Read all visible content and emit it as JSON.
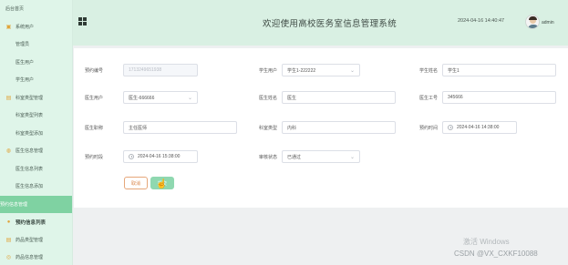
{
  "sidebar": {
    "items": [
      {
        "label": "后台首页",
        "kind": "top"
      },
      {
        "label": "系统用户",
        "kind": "group",
        "icon": "user-group-icon"
      },
      {
        "label": "管理员",
        "kind": "sub"
      },
      {
        "label": "医生用户",
        "kind": "sub"
      },
      {
        "label": "学生用户",
        "kind": "sub"
      },
      {
        "label": "科室类型管理",
        "kind": "group",
        "icon": "folder-icon"
      },
      {
        "label": "科室类型列表",
        "kind": "sub"
      },
      {
        "label": "科室类型添加",
        "kind": "sub"
      },
      {
        "label": "医生信息管理",
        "kind": "group",
        "icon": "doctor-icon"
      },
      {
        "label": "医生信息列表",
        "kind": "sub"
      },
      {
        "label": "医生信息添加",
        "kind": "sub"
      },
      {
        "label": "预约信息管理",
        "kind": "active"
      },
      {
        "label": "预约信息列表",
        "kind": "group2",
        "icon": "location-pin-icon"
      },
      {
        "label": "药品类型管理",
        "kind": "group",
        "icon": "folder-icon"
      },
      {
        "label": "药品信息管理",
        "kind": "group",
        "icon": "pill-icon"
      }
    ]
  },
  "header": {
    "title": "欢迎使用高校医务室信息管理系统",
    "datetime": "2024-04-16 14:40:47",
    "username": "admin"
  },
  "form": {
    "appointment_no_label": "预约编号",
    "appointment_no_value": "1713249651938",
    "student_user_label": "学生用户",
    "student_user_value": "学生1-222222",
    "student_name_label": "学生姓名",
    "student_name_value": "学生1",
    "doctor_user_label": "医生用户",
    "doctor_user_value": "医生-666666",
    "doctor_name_label": "医生姓名",
    "doctor_name_value": "医生",
    "doctor_id_label": "医生工号",
    "doctor_id_value": "345666",
    "doctor_title_label": "医生职称",
    "doctor_title_value": "主任医师",
    "dept_type_label": "科室类型",
    "dept_type_value": "内科",
    "appointment_time_label": "预约时间",
    "appointment_time_value": "2024-04-16 14:38:00",
    "slot_time_label": "预约时段",
    "slot_time_value": "2024-04-16 15:38:00",
    "review_status_label": "审核状态",
    "review_status_value": "已通过",
    "cancel_label": "取消",
    "submit_label": "提交"
  },
  "watermark": {
    "line1": "激活 Windows",
    "line2": "CSDN @VX_CXKF10088"
  }
}
